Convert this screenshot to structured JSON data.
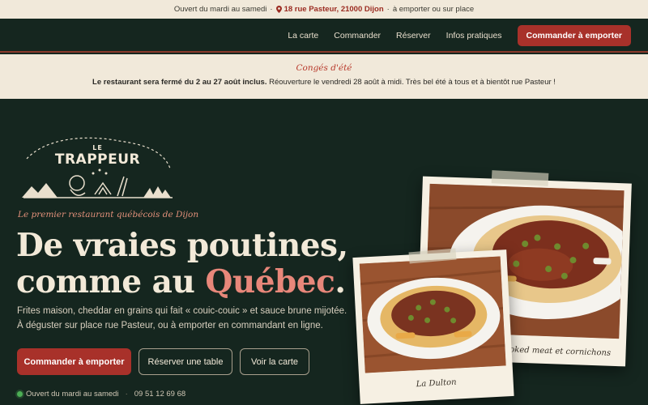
{
  "topbar": {
    "hours": "Ouvert du mardi au samedi",
    "sep1": "·",
    "address": "18 rue Pasteur, 21000 Dijon",
    "sep2": "·",
    "mode": "à emporter ou sur place"
  },
  "nav": {
    "items": [
      {
        "label": "La carte"
      },
      {
        "label": "Commander"
      },
      {
        "label": "Réserver"
      },
      {
        "label": "Infos pratiques"
      }
    ],
    "cta": "Commander à emporter"
  },
  "notice": {
    "title": "Congés d'été",
    "bold": "Le restaurant sera fermé du 2 au 27 août inclus.",
    "text": " Réouverture le vendredi 28 août à midi. Très bel été à tous et à bientôt rue Pasteur !"
  },
  "hero": {
    "logo_line1": "LE",
    "logo_line2": "TRAPPEUR",
    "tagline": "Le premier restaurant québécois de Dijon",
    "headline_line1": "De vraies poutines,",
    "headline_line2_a": "comme au ",
    "headline_line2_b": "Québec",
    "headline_line2_c": ".",
    "desc_line1": "Frites maison, cheddar en grains qui fait « couic-couic » et sauce brune mijotée.",
    "desc_line2": "À déguster sur place rue Pasteur, ou à emporter en commandant en ligne.",
    "btn_order": "Commander à emporter",
    "btn_reserve": "Réserver une table",
    "btn_menu": "Voir la carte",
    "status_text": "Ouvert du mardi au samedi",
    "status_sep": "·",
    "phone": "09 51 12 69 68"
  },
  "photos": [
    {
      "caption": "smoked meat et cornichons"
    },
    {
      "caption": "La Dulton"
    }
  ],
  "colors": {
    "accent": "#a8312a",
    "background": "#15261f",
    "cream": "#f1e9da",
    "highlight": "#e8877a",
    "open_dot": "#4cae55"
  },
  "icons": [
    "map-pin-icon",
    "open-status-dot-icon"
  ]
}
